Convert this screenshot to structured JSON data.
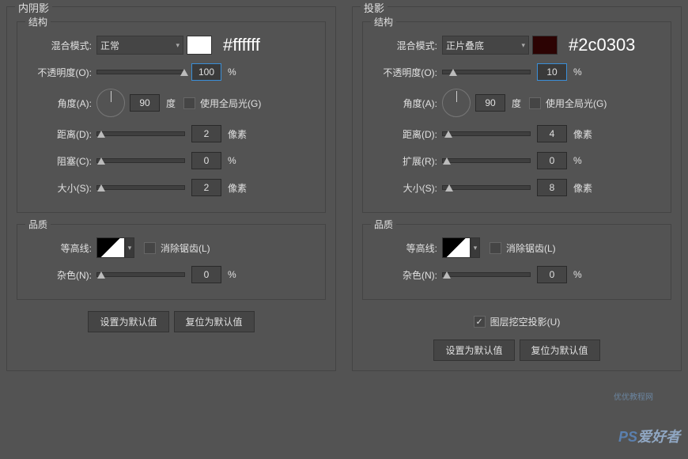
{
  "left": {
    "title": "内阴影",
    "structure": {
      "title": "结构",
      "blend": {
        "label": "混合模式:",
        "value": "正常",
        "swatch": "#ffffff",
        "note": "#ffffff"
      },
      "opacity": {
        "label": "不透明度(O):",
        "value": "100",
        "unit": "%"
      },
      "angle": {
        "label": "角度(A):",
        "value": "90",
        "unit": "度",
        "global": "使用全局光(G)",
        "globalChecked": false
      },
      "distance": {
        "label": "距离(D):",
        "value": "2",
        "unit": "像素"
      },
      "choke": {
        "label": "阻塞(C):",
        "value": "0",
        "unit": "%"
      },
      "size": {
        "label": "大小(S):",
        "value": "2",
        "unit": "像素"
      }
    },
    "quality": {
      "title": "品质",
      "contour": {
        "label": "等高线:",
        "anti": "消除锯齿(L)",
        "antiChecked": false
      },
      "noise": {
        "label": "杂色(N):",
        "value": "0",
        "unit": "%"
      }
    },
    "btnDefault": "设置为默认值",
    "btnReset": "复位为默认值"
  },
  "right": {
    "title": "投影",
    "structure": {
      "title": "结构",
      "blend": {
        "label": "混合模式:",
        "value": "正片叠底",
        "swatch": "#2c0303",
        "note": "#2c0303"
      },
      "opacity": {
        "label": "不透明度(O):",
        "value": "10",
        "unit": "%"
      },
      "angle": {
        "label": "角度(A):",
        "value": "90",
        "unit": "度",
        "global": "使用全局光(G)",
        "globalChecked": false
      },
      "distance": {
        "label": "距离(D):",
        "value": "4",
        "unit": "像素"
      },
      "spread": {
        "label": "扩展(R):",
        "value": "0",
        "unit": "%"
      },
      "size": {
        "label": "大小(S):",
        "value": "8",
        "unit": "像素"
      }
    },
    "quality": {
      "title": "品质",
      "contour": {
        "label": "等高线:",
        "anti": "消除锯齿(L)",
        "antiChecked": false
      },
      "noise": {
        "label": "杂色(N):",
        "value": "0",
        "unit": "%"
      }
    },
    "knockout": {
      "label": "图层挖空投影(U)",
      "checked": true
    },
    "btnDefault": "设置为默认值",
    "btnReset": "复位为默认值"
  },
  "watermark1": "优优教程网",
  "watermark2a": "PS",
  "watermark2b": "爱好者"
}
